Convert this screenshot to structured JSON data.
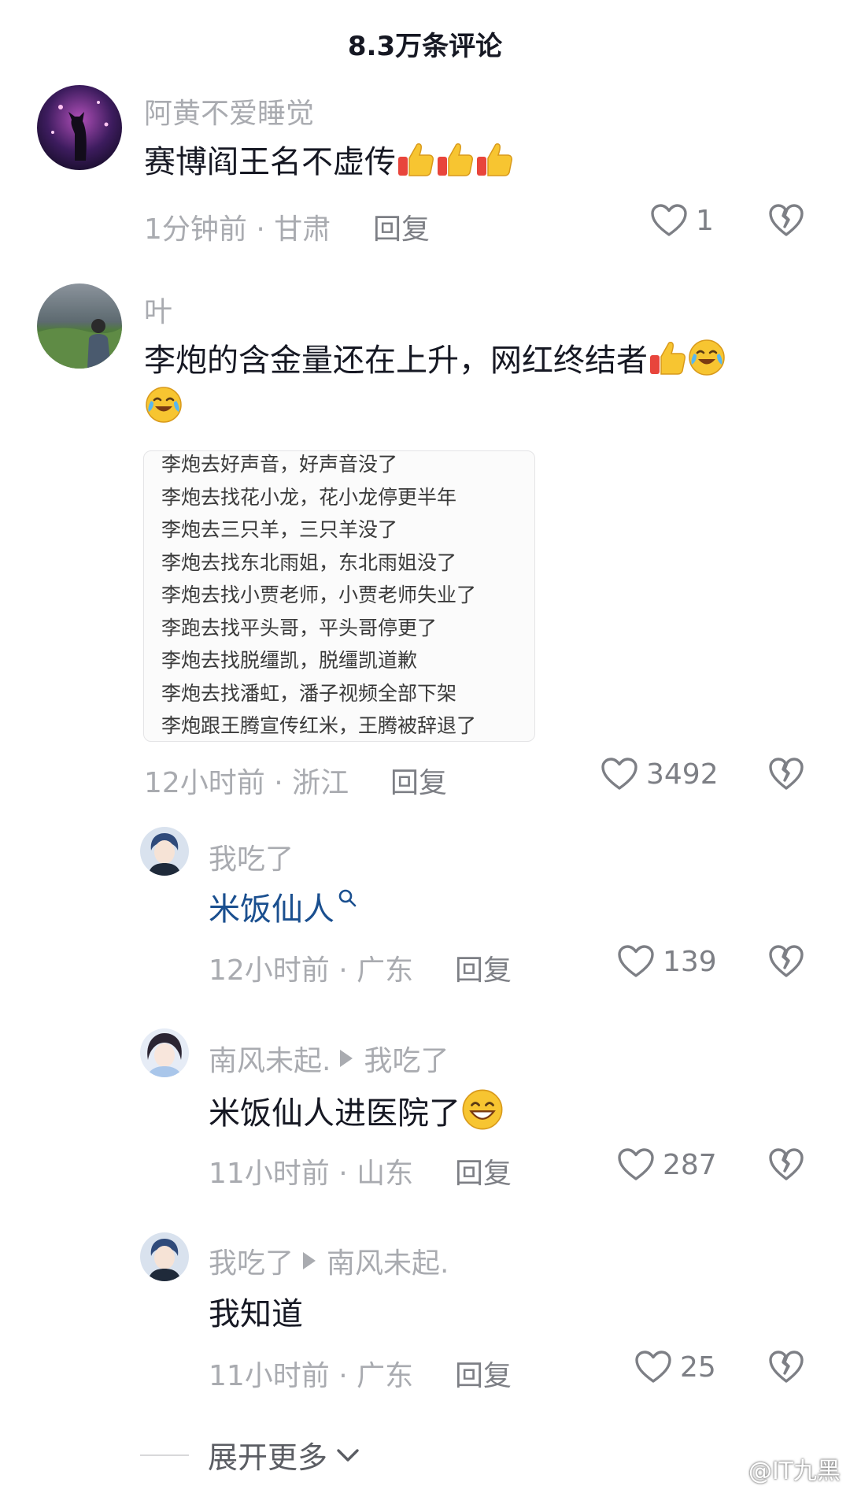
{
  "header": {
    "title": "8.3万条评论"
  },
  "comments": [
    {
      "username": "阿黄不爱睡觉",
      "text": "赛博阎王名不虚传",
      "meta": "1分钟前 · 甘肃",
      "reply_label": "回复",
      "likes": "1"
    },
    {
      "username": "叶",
      "text_line1": "李炮的含金量还在上升，网红终结者",
      "meta": "12小时前 · 浙江",
      "reply_label": "回复",
      "likes": "3492",
      "image_lines": [
        "李炮去好声音，好声音没了",
        "李炮去找花小龙，花小龙停更半年",
        "李炮去三只羊，三只羊没了",
        "李炮去找东北雨姐，东北雨姐没了",
        "李炮去找小贾老师，小贾老师失业了",
        "李跑去找平头哥，平头哥停更了",
        "李炮去找脱缰凯，脱缰凯道歉",
        "李炮去找潘虹，潘子视频全部下架",
        "李炮跟王腾宣传红米，王腾被辞退了"
      ]
    },
    {
      "username": "我吃了",
      "text": "米饭仙人",
      "meta": "12小时前 · 广东",
      "reply_label": "回复",
      "likes": "139"
    },
    {
      "username": "南风未起.",
      "reply_to": "我吃了",
      "text": "米饭仙人进医院了",
      "meta": "11小时前 · 山东",
      "reply_label": "回复",
      "likes": "287"
    },
    {
      "username": "我吃了",
      "reply_to": "南风未起.",
      "text": "我知道",
      "meta": "11小时前 · 广东",
      "reply_label": "回复",
      "likes": "25"
    }
  ],
  "expand_more": {
    "label": "展开更多"
  },
  "watermark": {
    "text": "@IT九黑"
  },
  "colors": {
    "link": "#1a4f8f",
    "muted": "#a9abb0",
    "text": "#161823"
  }
}
